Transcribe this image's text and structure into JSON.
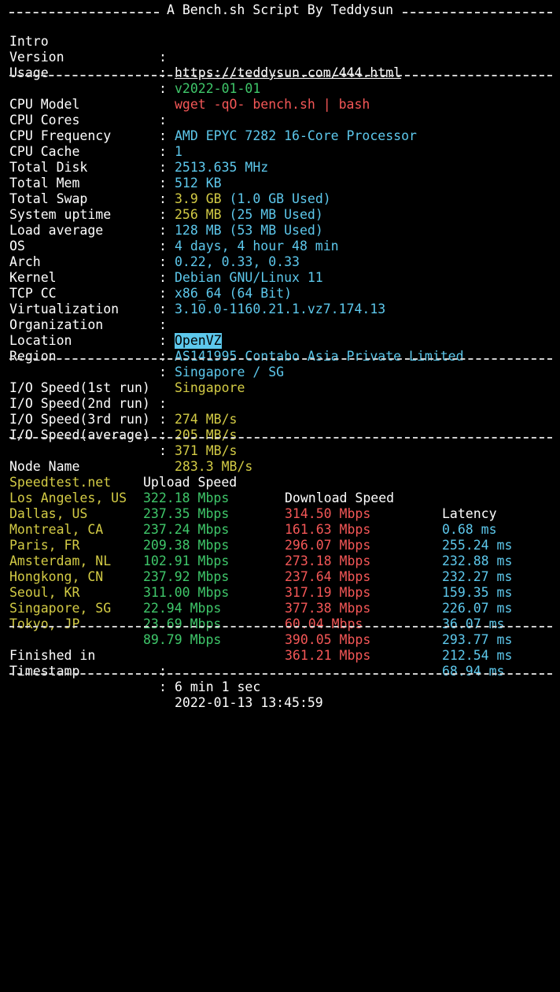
{
  "banner": {
    "title": "A Bench.sh Script By Teddysun"
  },
  "intro": [
    {
      "label": "Intro",
      "value": "https://teddysun.com/444.html"
    },
    {
      "label": "Version",
      "value": "v2022-01-01"
    },
    {
      "label": "Usage",
      "value": "wget -qO- bench.sh | bash"
    }
  ],
  "system": {
    "cpu_model": {
      "label": "CPU Model",
      "value": "AMD EPYC 7282 16-Core Processor"
    },
    "cpu_cores": {
      "label": "CPU Cores",
      "value": "1"
    },
    "cpu_freq": {
      "label": "CPU Frequency",
      "value": "2513.635 MHz"
    },
    "cpu_cache": {
      "label": "CPU Cache",
      "value": "512 KB"
    },
    "total_disk": {
      "label": "Total Disk",
      "value": "3.9 GB",
      "used": "(1.0 GB Used)"
    },
    "total_mem": {
      "label": "Total Mem",
      "value": "256 MB",
      "used": "(25 MB Used)"
    },
    "total_swap": {
      "label": "Total Swap",
      "value": "128 MB",
      "used": "(53 MB Used)"
    },
    "uptime": {
      "label": "System uptime",
      "value": "4 days, 4 hour 48 min"
    },
    "load": {
      "label": "Load average",
      "value": "0.22, 0.33, 0.33"
    },
    "os": {
      "label": "OS",
      "value": "Debian GNU/Linux 11"
    },
    "arch": {
      "label": "Arch",
      "value": "x86_64 (64 Bit)"
    },
    "kernel": {
      "label": "Kernel",
      "value": "3.10.0-1160.21.1.vz7.174.13"
    },
    "tcp_cc": {
      "label": "TCP CC",
      "value": ""
    },
    "virt": {
      "label": "Virtualization",
      "value": "OpenVZ"
    },
    "org": {
      "label": "Organization",
      "value": "AS141995 Contabo Asia Private Limited"
    },
    "location": {
      "label": "Location",
      "value": "Singapore / SG"
    },
    "region": {
      "label": "Region",
      "value": "Singapore"
    }
  },
  "io": [
    {
      "label": "I/O Speed(1st run)",
      "value": "274 MB/s"
    },
    {
      "label": "I/O Speed(2nd run)",
      "value": "205 MB/s"
    },
    {
      "label": "I/O Speed(3rd run)",
      "value": "371 MB/s"
    },
    {
      "label": "I/O Speed(average)",
      "value": "283.3 MB/s"
    }
  ],
  "speedtest": {
    "headers": [
      "Node Name",
      "Upload Speed",
      "Download Speed",
      "Latency"
    ],
    "rows": [
      {
        "node": "Speedtest.net",
        "up": "322.18 Mbps",
        "down": "314.50 Mbps",
        "lat": "0.68 ms"
      },
      {
        "node": "Los Angeles, US",
        "up": "237.35 Mbps",
        "down": "161.63 Mbps",
        "lat": "255.24 ms"
      },
      {
        "node": "Dallas, US",
        "up": "237.24 Mbps",
        "down": "296.07 Mbps",
        "lat": "232.88 ms"
      },
      {
        "node": "Montreal, CA",
        "up": "209.38 Mbps",
        "down": "273.18 Mbps",
        "lat": "232.27 ms"
      },
      {
        "node": "Paris, FR",
        "up": "102.91 Mbps",
        "down": "237.64 Mbps",
        "lat": "159.35 ms"
      },
      {
        "node": "Amsterdam, NL",
        "up": "237.92 Mbps",
        "down": "317.19 Mbps",
        "lat": "226.07 ms"
      },
      {
        "node": "Hongkong, CN",
        "up": "311.00 Mbps",
        "down": "377.38 Mbps",
        "lat": "36.07 ms"
      },
      {
        "node": "Seoul, KR",
        "up": "22.94 Mbps",
        "down": "60.04 Mbps",
        "lat": "293.77 ms"
      },
      {
        "node": "Singapore, SG",
        "up": "23.69 Mbps",
        "down": "390.05 Mbps",
        "lat": "212.54 ms"
      },
      {
        "node": "Tokyo, JP",
        "up": "89.79 Mbps",
        "down": "361.21 Mbps",
        "lat": "68.94 ms"
      }
    ]
  },
  "footer": [
    {
      "label": "Finished in",
      "value": "6 min 1 sec"
    },
    {
      "label": "Timestamp",
      "value": "2022-01-13 13:45:59"
    }
  ],
  "colon": ":",
  "colors": {
    "background": "#000000",
    "label": "#ffffff",
    "green": "#3fc76a",
    "red": "#f45757",
    "cyan": "#5dc8ec",
    "yellow": "#d3cb45",
    "separator": "#cfcfcf"
  }
}
